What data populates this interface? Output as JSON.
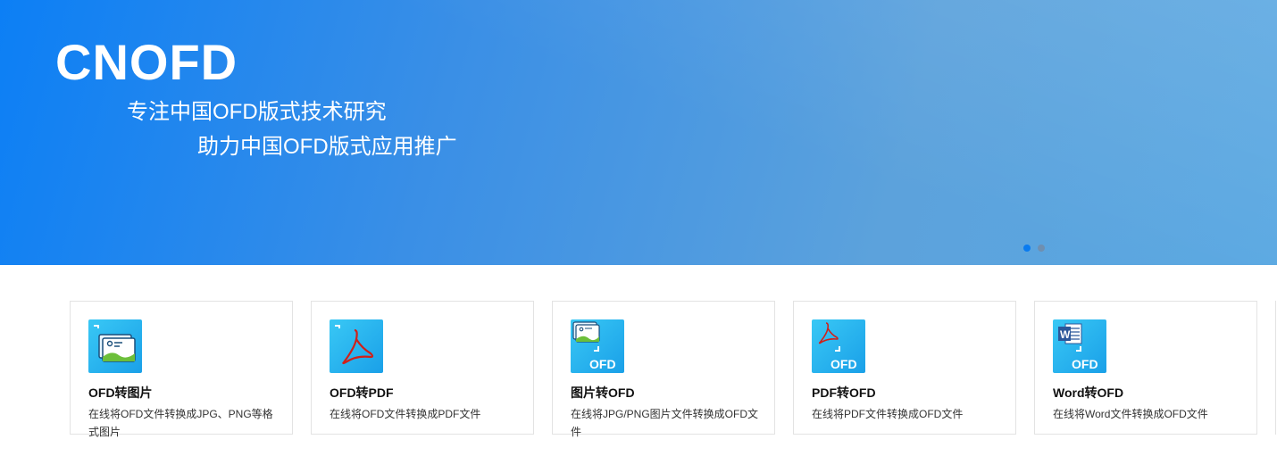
{
  "banner": {
    "brand": "CNOFD",
    "slogan_line1": "专注中国OFD版式技术研究",
    "slogan_line2": "助力中国OFD版式应用推广",
    "carousel_count": 2,
    "carousel_active": 1
  },
  "cards": [
    {
      "title": "OFD转图片",
      "desc": "在线将OFD文件转换成JPG、PNG等格式图片",
      "icon": "image-convert-icon"
    },
    {
      "title": "OFD转PDF",
      "desc": "在线将OFD文件转换成PDF文件",
      "icon": "pdf-icon"
    },
    {
      "title": "图片转OFD",
      "desc": "在线将JPG/PNG图片文件转换成OFD文件",
      "icon": "image-to-ofd-icon"
    },
    {
      "title": "PDF转OFD",
      "desc": "在线将PDF文件转换成OFD文件",
      "icon": "pdf-to-ofd-icon"
    },
    {
      "title": "Word转OFD",
      "desc": "在线将Word文件转换成OFD文件",
      "icon": "word-to-ofd-icon"
    }
  ],
  "icon_text": {
    "ofd": "OFD",
    "word_letter": "W"
  },
  "colors": {
    "accent": "#0a7bf0",
    "banner_start": "#0c7ff5",
    "banner_end": "#5aa8e2",
    "icon_bg": "#1aa0e8"
  }
}
